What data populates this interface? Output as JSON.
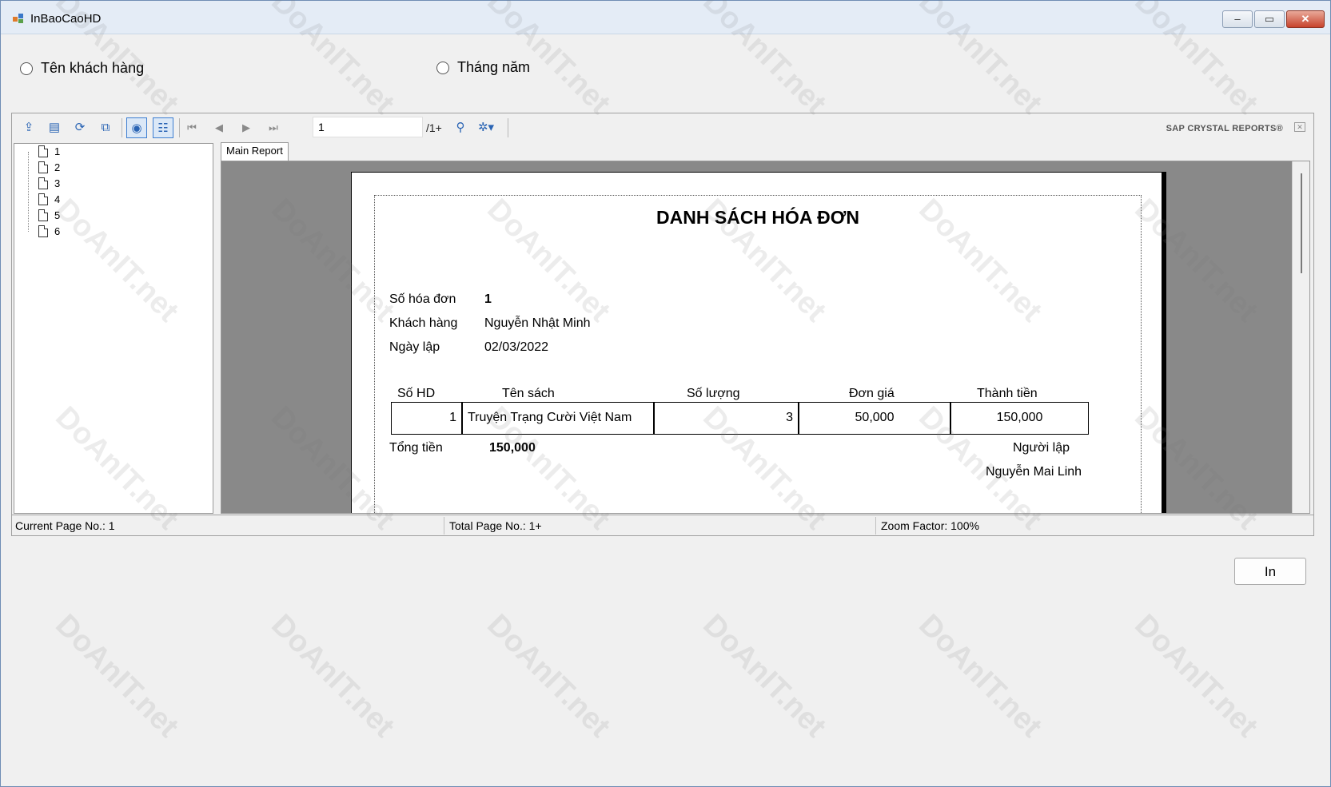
{
  "window": {
    "title": "InBaoCaoHD"
  },
  "filters": {
    "option1": "Tên khách hàng",
    "option2": "Tháng năm"
  },
  "viewer": {
    "page_value": "1",
    "page_total": "/1+",
    "brand": "SAP CRYSTAL REPORTS®",
    "tab_label": "Main Report",
    "tree_items": [
      "1",
      "2",
      "3",
      "4",
      "5",
      "6"
    ],
    "status": {
      "current": "Current Page No.: 1",
      "total": "Total Page No.: 1+",
      "zoom": "Zoom Factor: 100%"
    }
  },
  "report": {
    "title": "DANH SÁCH HÓA ĐƠN",
    "invoice_label": "Số hóa đơn",
    "invoice_value": "1",
    "customer_label": "Khách hàng",
    "customer_value": "Nguyễn Nhật Minh",
    "date_label": "Ngày lập",
    "date_value": "02/03/2022",
    "columns": [
      "Số HD",
      "Tên sách",
      "Số lượng",
      "Đơn giá",
      "Thành tiền"
    ],
    "row": {
      "id": "1",
      "book": "Truyện Trạng Cười Việt Nam",
      "qty": "3",
      "price": "50,000",
      "amount": "150,000"
    },
    "total_label": "Tổng tiền",
    "total_value": "150,000",
    "creator_label": "Người lập",
    "creator_value": "Nguyễn Mai Linh"
  },
  "actions": {
    "print_label": "In"
  },
  "watermark": "DoAnIT.net"
}
